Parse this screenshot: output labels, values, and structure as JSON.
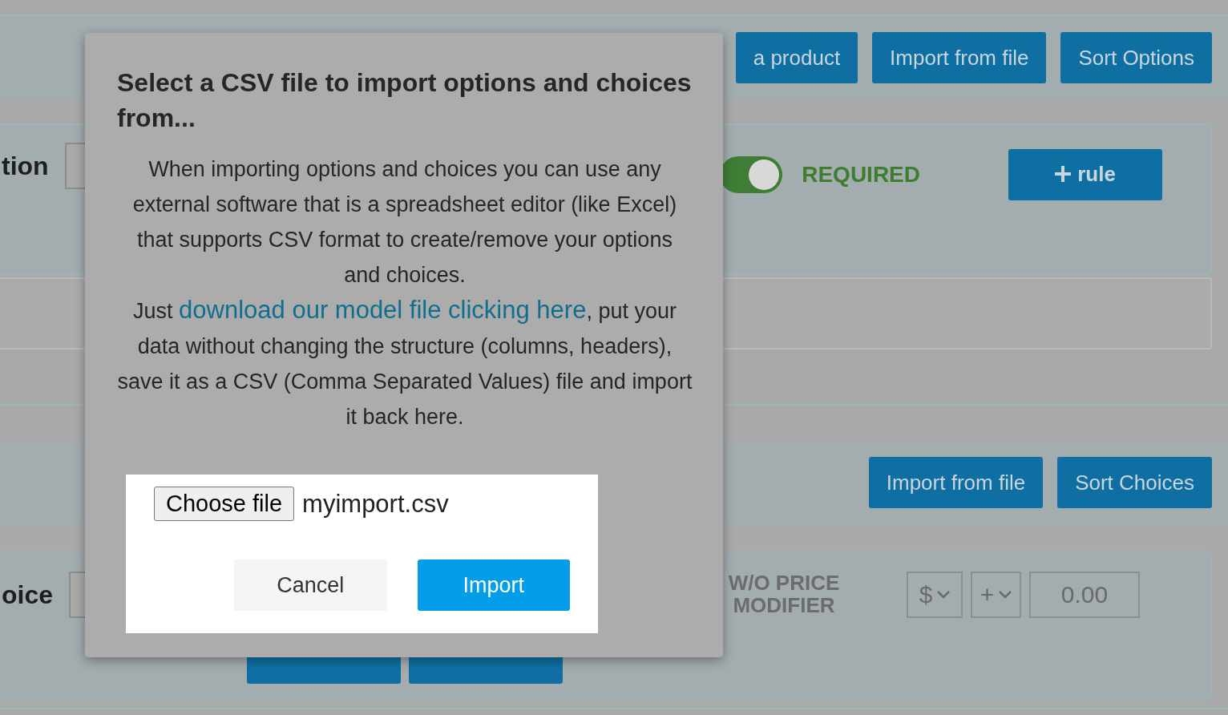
{
  "header_bar": {
    "buttons": [
      "a product",
      "Import from file",
      "Sort Options"
    ]
  },
  "option_card": {
    "label": "tion",
    "required": {
      "on": true,
      "label": "REQUIRED"
    },
    "rule_button": "rule"
  },
  "choices_bar": {
    "buttons": [
      "Import from file",
      "Sort Choices"
    ]
  },
  "choice_card": {
    "label": "oice",
    "price_modifier_label": "W/O PRICE MODIFIER",
    "currency": "$",
    "sign": "+",
    "amount": "0.00"
  },
  "dialog": {
    "title": "Select a CSV file to import options and choices from...",
    "intro": "When importing options and choices you can use any external software that is a spreadsheet editor (like Excel) that supports CSV format to create/remove your options and choices.",
    "lead": "Just",
    "link": "download our model file clicking here",
    "rest": ", put your data without changing the structure (columns, headers), save it as a CSV (Comma Separated Values) file and import it back here.",
    "file_button": "Choose file",
    "file_name": "myimport.csv",
    "cancel": "Cancel",
    "confirm": "Import"
  }
}
